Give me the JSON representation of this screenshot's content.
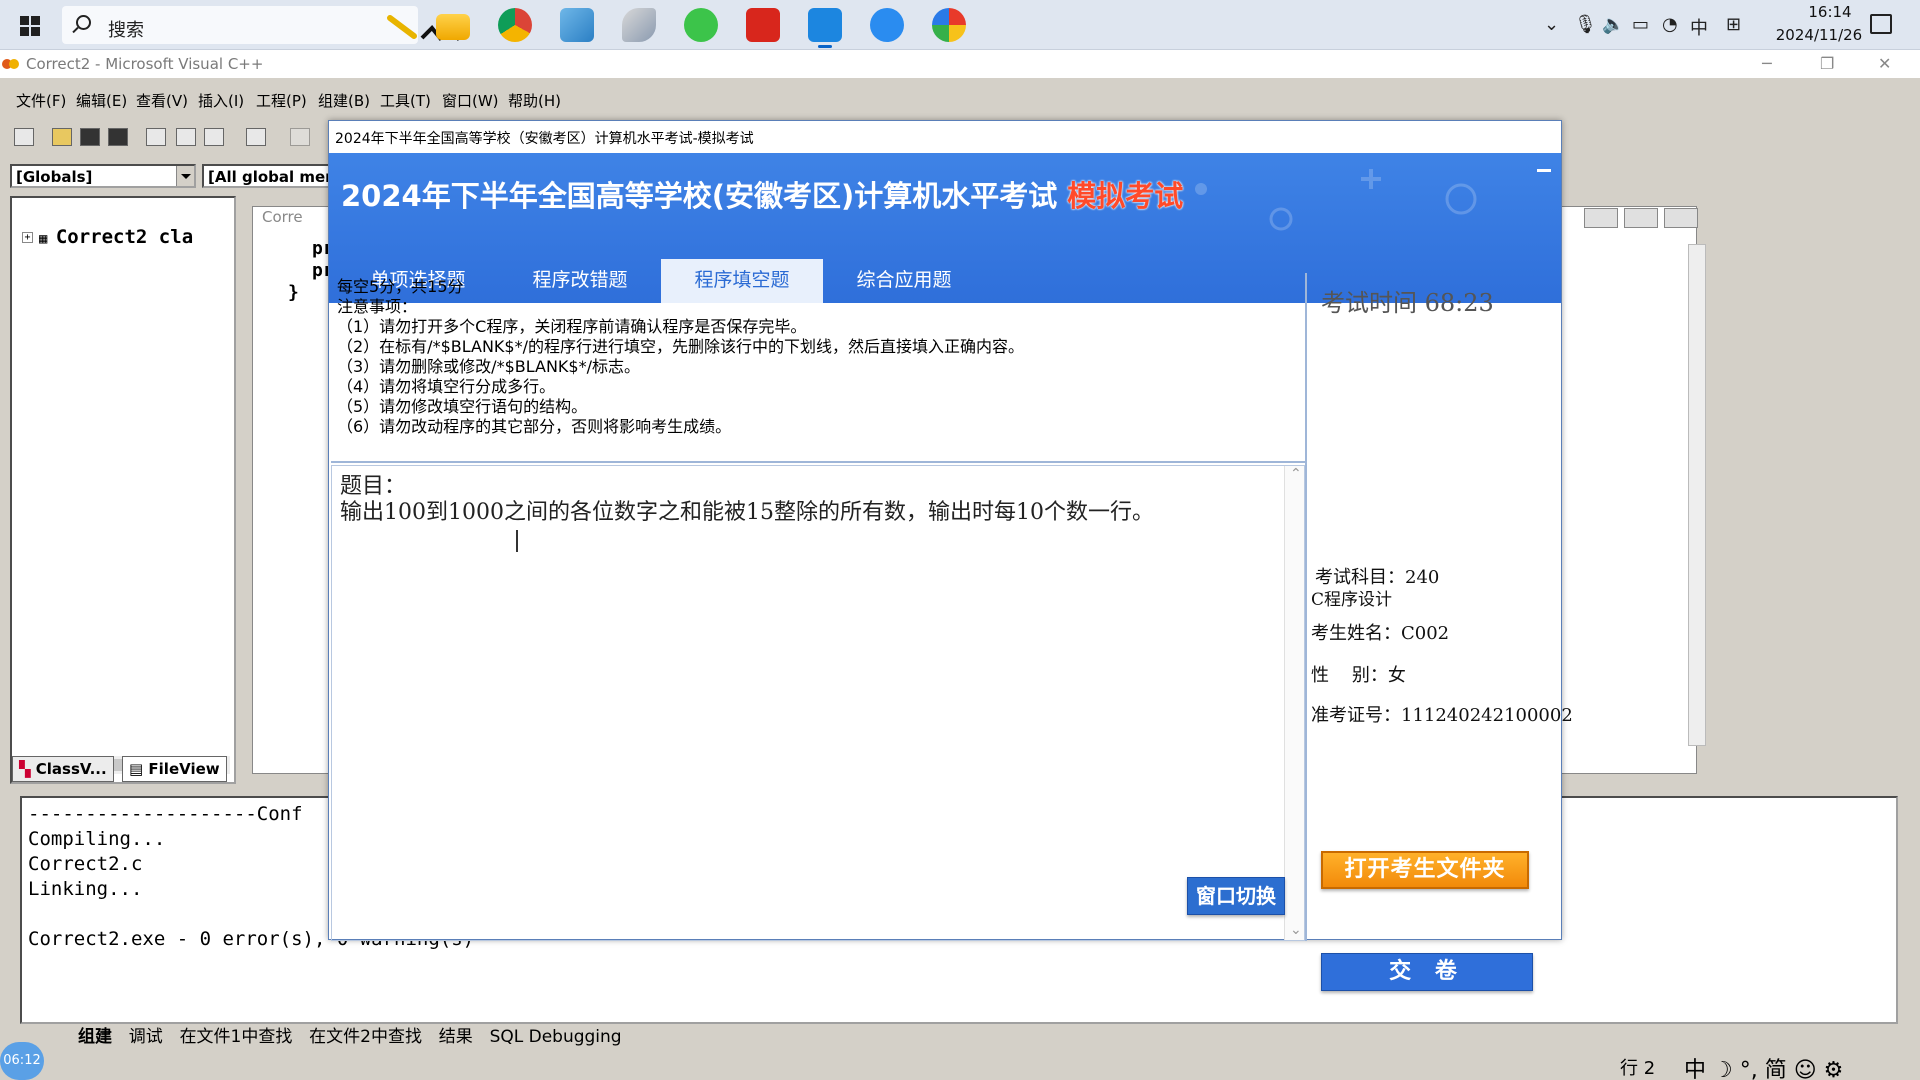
{
  "taskbar": {
    "search_placeholder": "搜索",
    "clock_time": "16:14",
    "clock_date": "2024/11/26",
    "ime_lang": "中",
    "apps": [
      "file-explorer",
      "chrome",
      "notes",
      "feather-app",
      "wechat",
      "acrobat",
      "remote-desktop",
      "qq-browser",
      "paint-app"
    ]
  },
  "vc": {
    "title": "Correct2 - Microsoft Visual C++",
    "menus": [
      "文件(F)",
      "编辑(E)",
      "查看(V)",
      "插入(I)",
      "工程(P)",
      "组建(B)",
      "工具(T)",
      "窗口(W)",
      "帮助(H)"
    ],
    "globals_combo": "[Globals]",
    "members_combo": "[All global mem",
    "workspace_tree_item": "Correct2 cla",
    "workspace_tabs": [
      "ClassV...",
      "FileView"
    ],
    "editor_tab": "Corre",
    "editor_code": [
      "pr",
      "pr",
      "}"
    ],
    "output_lines": [
      "--------------------Conf",
      "Compiling...",
      "Correct2.c",
      "Linking...",
      "",
      "Correct2.exe - 0 error(s), 0 warning(s)"
    ],
    "output_tabs": [
      "组建",
      "调试",
      "在文件1中查找",
      "在文件2中查找",
      "结果",
      "SQL Debugging"
    ],
    "status_line": "行 2",
    "ime_icons": "中 ☽ °, 简 ☺ ⚙",
    "recording_badge": "06:12"
  },
  "exam": {
    "window_title": "2024年下半年全国高等学校（安徽考区）计算机水平考试-模拟考试",
    "heading": "2024年下半年全国高等学校(安徽考区)计算机水平考试",
    "heading_badge": "模拟考试",
    "tabs": [
      "单项选择题",
      "程序改错题",
      "程序填空题",
      "综合应用题"
    ],
    "active_tab_index": 2,
    "notice_lines": [
      "每空5分，共15分",
      "注意事项：",
      "（1）请勿打开多个C程序，关闭程序前请确认程序是否保存完毕。",
      "（2）在标有/*$BLANK$*/的程序行进行填空，先删除该行中的下划线，然后直接填入正确内容。",
      "（3）请勿删除或修改/*$BLANK$*/标志。",
      "（4）请勿将填空行分成多行。",
      "（5）请勿修改填空行语句的结构。",
      "（6）请勿改动程序的其它部分，否则将影响考生成绩。"
    ],
    "question_label": "题目：",
    "question_text": "输出100到1000之间的各位数字之和能被15整除的所有数，输出时每10个数一行。",
    "timer_label": "考试时间",
    "timer_value": "68:23",
    "subject_label": "考试科目：",
    "subject_code": "240",
    "subject_name": "C程序设计",
    "name_label": "考生姓名：",
    "name_value": "C002",
    "gender_label": "性    别：",
    "gender_value": "女",
    "ticket_label": "准考证号：",
    "ticket_value": "111240242100002",
    "open_folder_label": "打开考生文件夹",
    "submit_label": "交  卷",
    "switch_window_label": "窗口切换",
    "colors": {
      "header_blue": "#3f83e6",
      "badge_red": "#ff4a2a",
      "folder_orange": "#f28a0a"
    }
  }
}
